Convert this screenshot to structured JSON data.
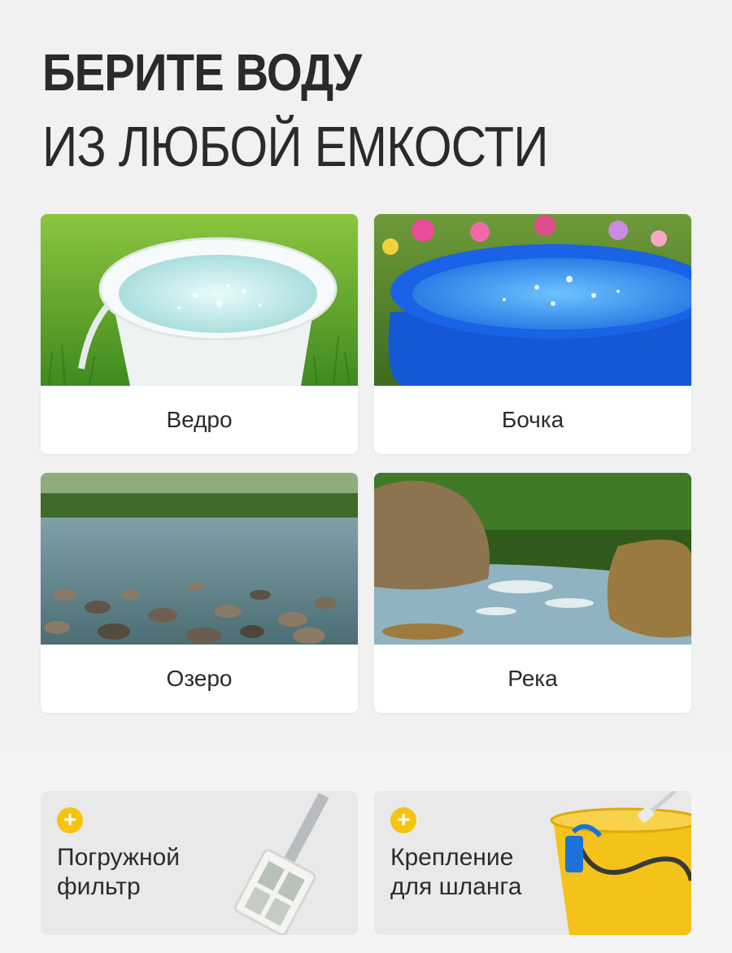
{
  "headline": {
    "line1": "БЕРИТЕ ВОДУ",
    "line2": "ИЗ ЛЮБОЙ ЕМКОСТИ"
  },
  "sources": [
    {
      "label": "Ведро",
      "image": "bucket-on-grass"
    },
    {
      "label": "Бочка",
      "image": "blue-barrel-water"
    },
    {
      "label": "Озеро",
      "image": "lake-pebbles"
    },
    {
      "label": "Река",
      "image": "river-rocks"
    }
  ],
  "accessories": [
    {
      "icon": "plus-icon",
      "line1": "Погружной",
      "line2": "фильтр",
      "image": "immersion-filter"
    },
    {
      "icon": "plus-icon",
      "line1": "Крепление",
      "line2": "для шланга",
      "image": "hose-clip-bucket"
    }
  ],
  "colors": {
    "accent": "#f6c40f",
    "background": "#f1f1f1",
    "card": "#ffffff"
  }
}
